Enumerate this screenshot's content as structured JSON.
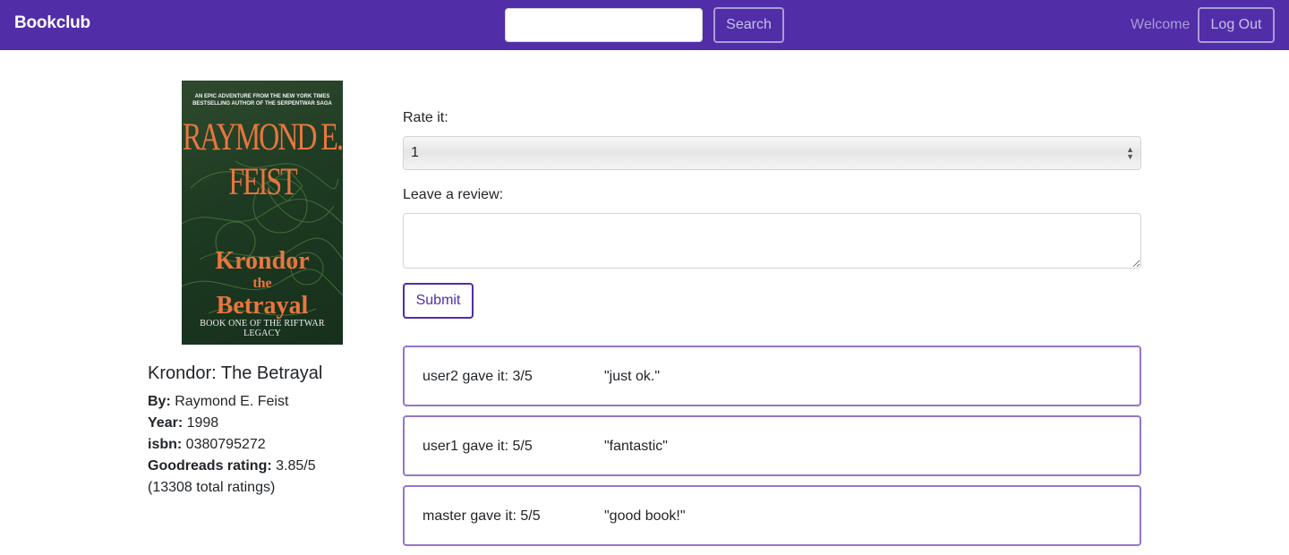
{
  "navbar": {
    "brand": "Bookclub",
    "search_placeholder": "",
    "search_label": "Search",
    "welcome": "Welcome",
    "logout_label": "Log Out",
    "color": "#512da8"
  },
  "book": {
    "cover": {
      "tagline": "AN EPIC ADVENTURE FROM THE NEW YORK TIMES BESTSELLING AUTHOR OF THE SERPENTWAR SAGA",
      "author": "RAYMOND E. FEIST",
      "title_top": "Krondor",
      "title_the": "the",
      "title_bottom": "Betrayal",
      "series": "BOOK ONE OF THE RIFTWAR LEGACY"
    },
    "title": "Krondor: The Betrayal",
    "by_label": "By:",
    "by": "Raymond E. Feist",
    "year_label": "Year:",
    "year": "1998",
    "isbn_label": "isbn:",
    "isbn": "0380795272",
    "goodreads_label": "Goodreads rating:",
    "goodreads_rating": "3.85/5",
    "total_ratings": "(13308 total ratings)"
  },
  "form": {
    "rate_label": "Rate it:",
    "rate_value": "1",
    "review_label": "Leave a review:",
    "review_value": "",
    "submit_label": "Submit"
  },
  "reviews": [
    {
      "who": "user2 gave it: 3/5",
      "text": "\"just ok.\""
    },
    {
      "who": "user1 gave it: 5/5",
      "text": "\"fantastic\""
    },
    {
      "who": "master gave it: 5/5",
      "text": "\"good book!\""
    }
  ]
}
